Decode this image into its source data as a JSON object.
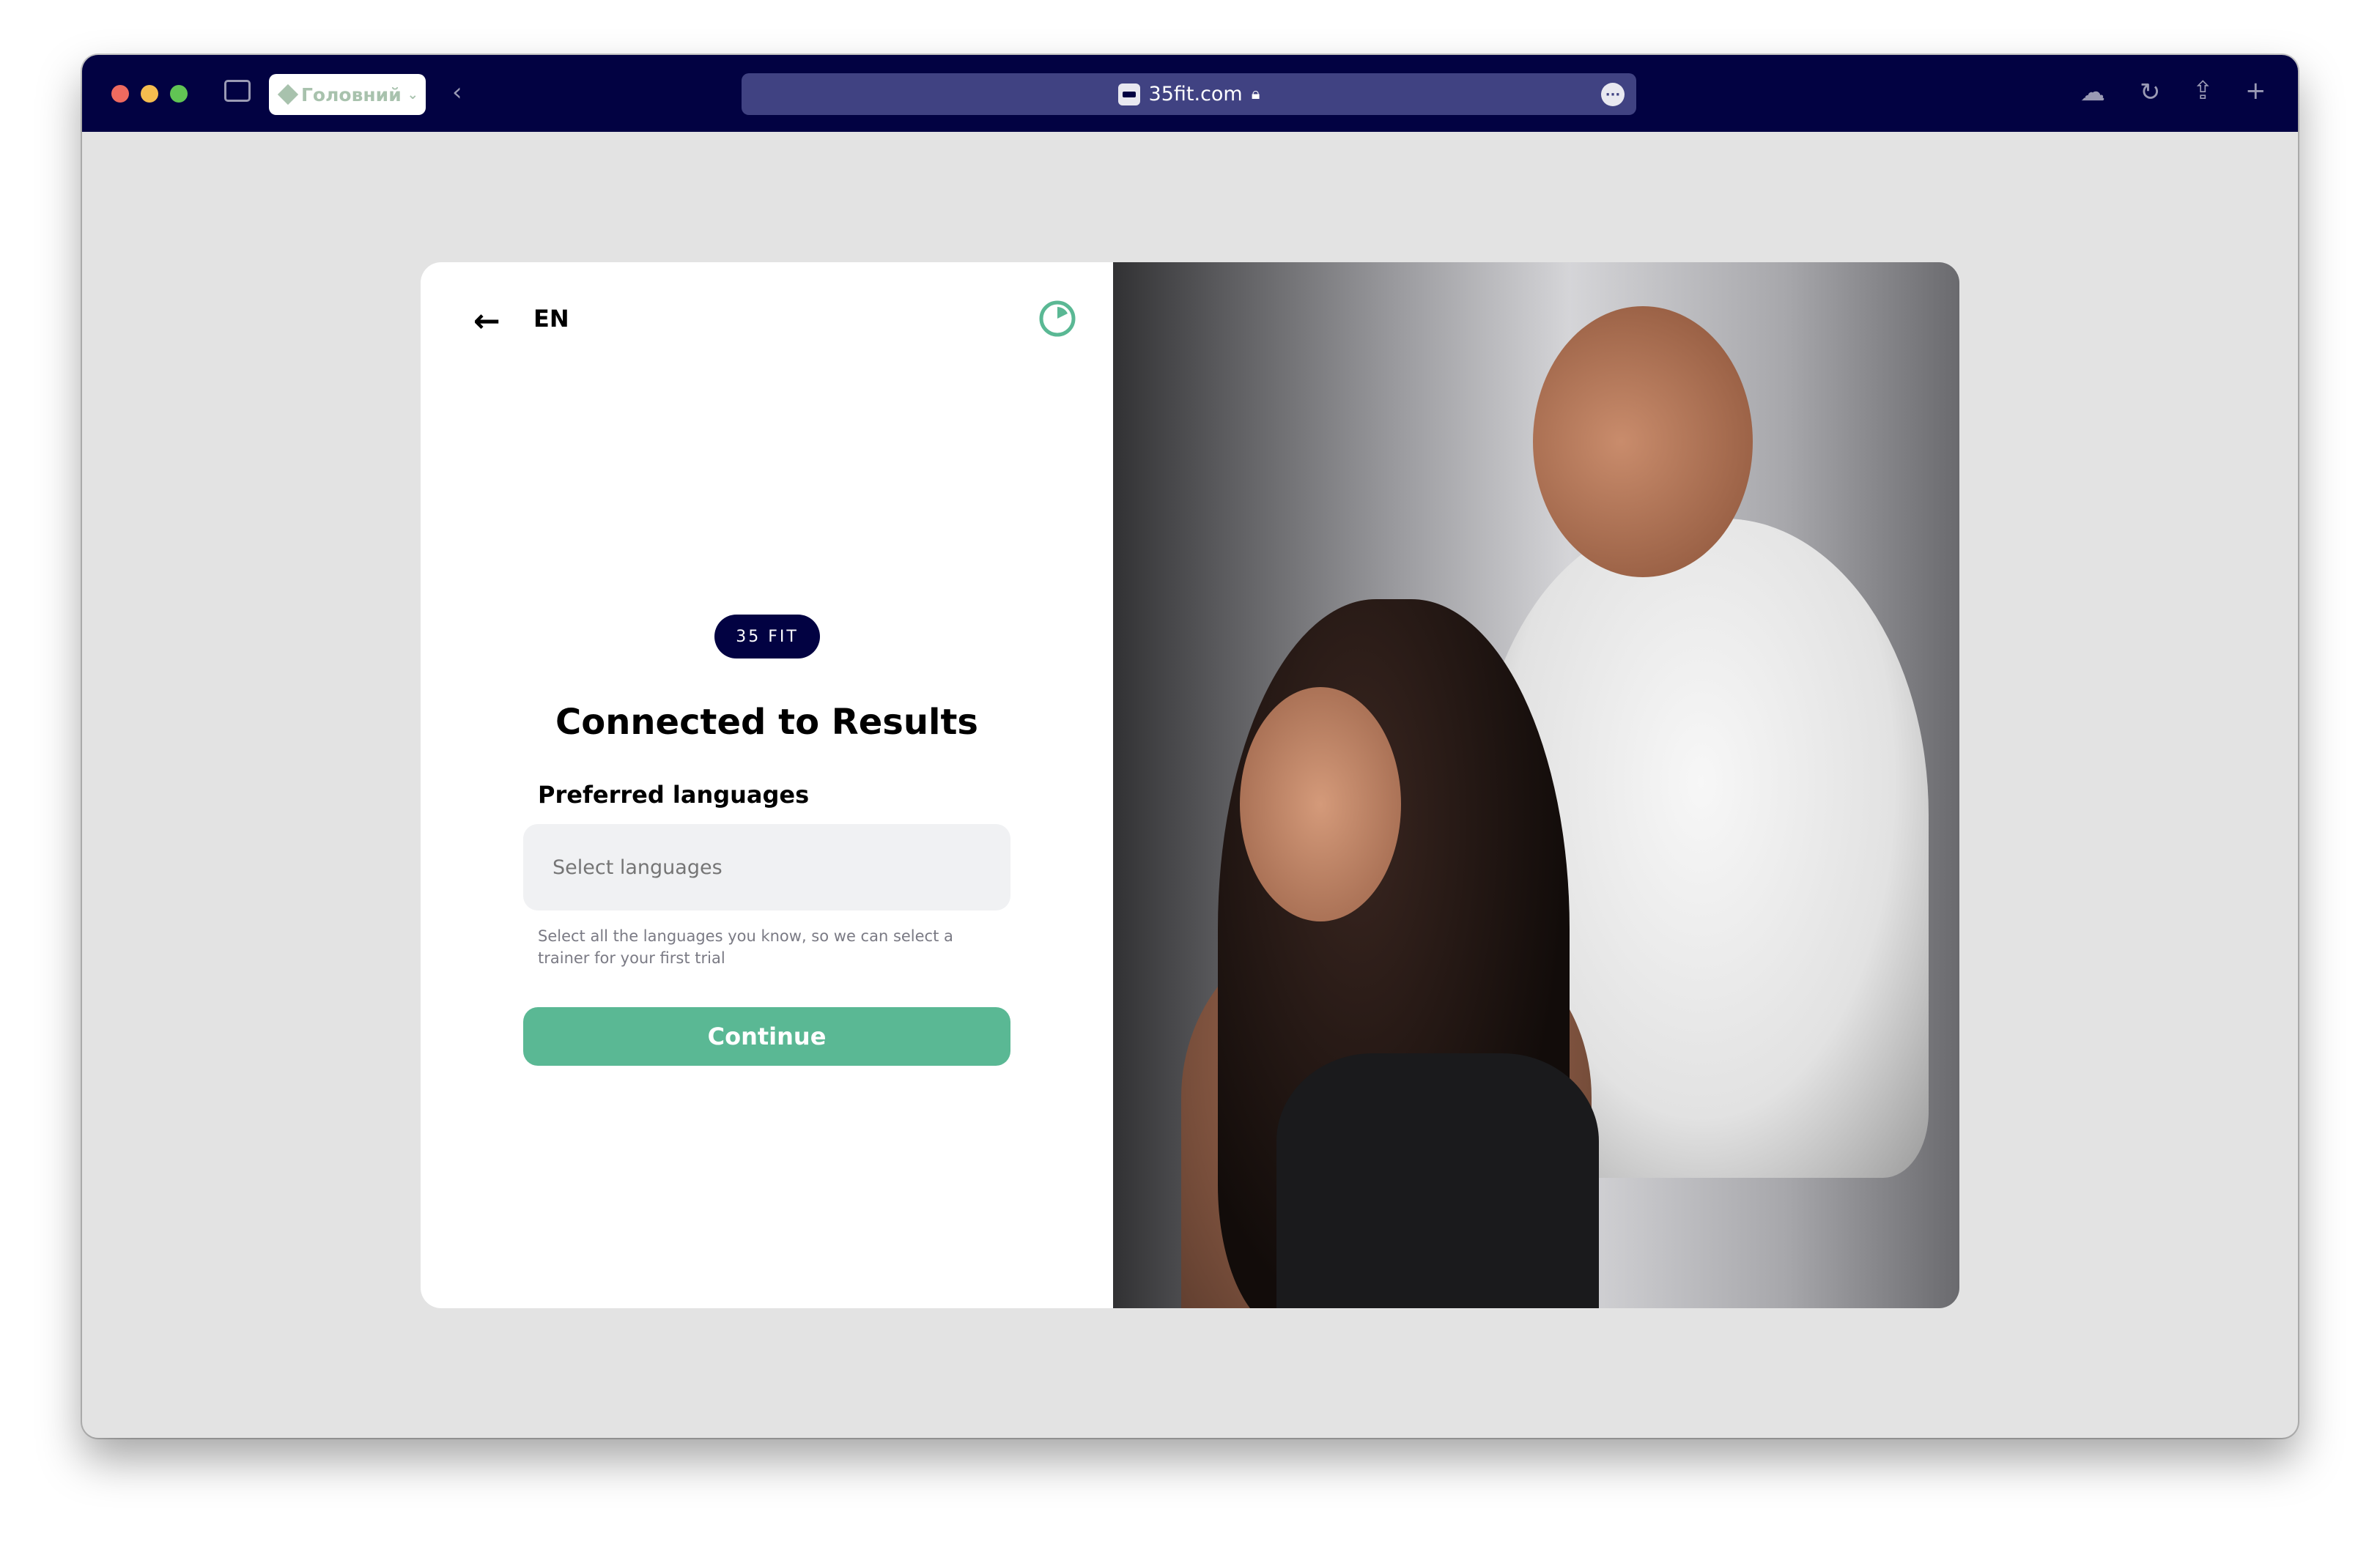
{
  "browser": {
    "tab_group_label": "Головний",
    "url": "35fit.com",
    "colors": {
      "toolbar": "#020242",
      "url_bar": "#404282"
    }
  },
  "page": {
    "language": "EN",
    "logo_text": "35 FIT",
    "title": "Connected to Results",
    "field_label": "Preferred languages",
    "input_placeholder": "Select languages",
    "helper_text": "Select all the languages you know, so we can select a trainer for your first trial",
    "continue_label": "Continue",
    "colors": {
      "accent": "#5ab894",
      "brand": "#020242"
    }
  }
}
